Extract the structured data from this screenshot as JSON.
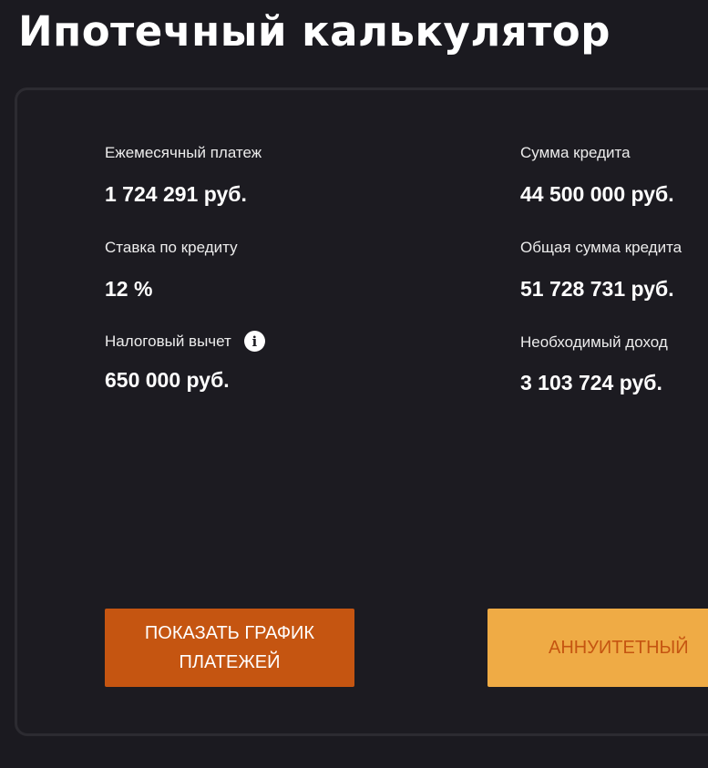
{
  "page": {
    "title": "Ипотечный калькулятор"
  },
  "stats": {
    "monthly_payment": {
      "label": "Ежемесячный платеж",
      "value": "1 724 291 руб."
    },
    "loan_amount": {
      "label": "Сумма кредита",
      "value": "44 500 000 руб."
    },
    "rate": {
      "label": "Ставка по кредиту",
      "value": "12 %"
    },
    "total_amount": {
      "label": "Общая сумма кредита",
      "value": "51 728 731 руб."
    },
    "tax_deduction": {
      "label": "Налоговый вычет",
      "value": "650 000 руб.",
      "icon": "info-icon"
    },
    "required_income": {
      "label": "Необходимый доход",
      "value": "3 103 724 руб."
    }
  },
  "buttons": {
    "show_schedule": "ПОКАЗАТЬ ГРАФИК ПЛАТЕЖЕЙ",
    "annuity": "АННУИТЕТНЫЙ"
  },
  "colors": {
    "background": "#1b1a20",
    "primary_button": "#c55511",
    "secondary_button": "#efab45"
  }
}
